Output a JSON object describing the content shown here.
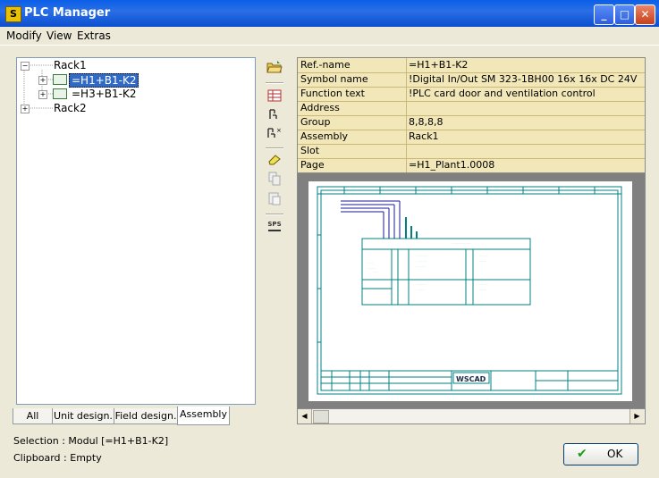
{
  "window": {
    "title": "PLC Manager",
    "app_icon_glyph": "S",
    "controls": {
      "minimize": "_",
      "maximize": "□",
      "close": "✕"
    }
  },
  "menu": [
    "Modify",
    "View",
    "Extras"
  ],
  "tree": [
    {
      "label": "Rack1",
      "expander": "−"
    },
    {
      "label": "=H1+B1-K2",
      "expander": "+",
      "selected": true
    },
    {
      "label": "=H3+B1-K2",
      "expander": "+"
    },
    {
      "label": "Rack2",
      "expander": "+"
    }
  ],
  "tabs": [
    "All",
    "Unit design.",
    "Field design.",
    "Assembly"
  ],
  "active_tab": "Assembly",
  "status": {
    "selection": "Selection : Modul [=H1+B1-K2]",
    "clipboard": "Clipboard : Empty"
  },
  "toolbar": {
    "open": "open-folder-icon",
    "table": "table-icon",
    "connect": "plug-icon",
    "connect_all": "plug-multi-icon",
    "erase": "eraser-icon",
    "copy": "copy-icon",
    "paste": "paste-icon",
    "sps_label": "SPS"
  },
  "properties": [
    {
      "key": "Ref.-name",
      "value": "=H1+B1-K2"
    },
    {
      "key": "Symbol name",
      "value": "!Digital In/Out SM 323-1BH00 16x 16x DC 24V"
    },
    {
      "key": "Function text",
      "value": "!PLC card door and ventilation control"
    },
    {
      "key": "Address",
      "value": ""
    },
    {
      "key": "Group",
      "value": "8,8,8,8"
    },
    {
      "key": "Assembly",
      "value": "Rack1"
    },
    {
      "key": "Slot",
      "value": ""
    },
    {
      "key": "Page",
      "value": "=H1_Plant1.0008"
    }
  ],
  "preview": {
    "logo_text": "WSCAD"
  },
  "ok_button": {
    "label": "OK"
  },
  "colors": {
    "drawing": "#008080",
    "highlight": "#316ac5",
    "prop_bg": "#f2e7b8"
  }
}
